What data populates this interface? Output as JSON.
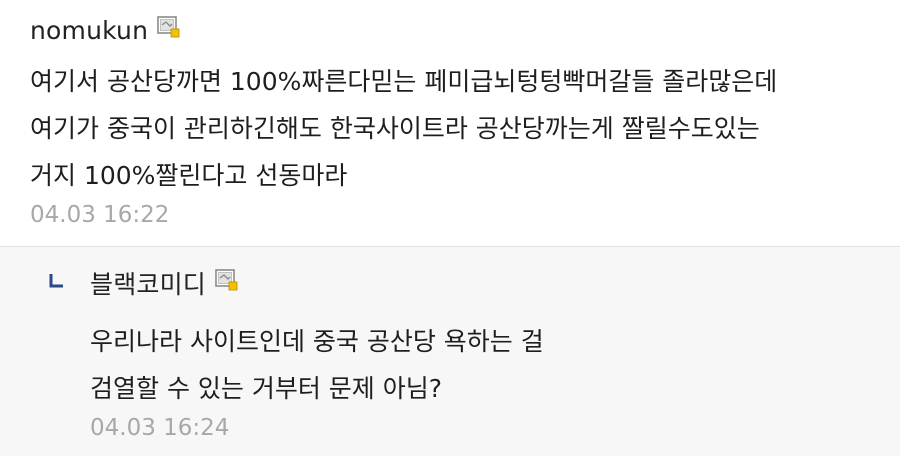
{
  "comment": {
    "author": "nomukun",
    "author_icon": "fixed-nick-icon",
    "lines": [
      "여기서 공산당까면 100%짜른다믿는 페미급뇌텅텅빡머갈들 졸라많은데",
      "여기가 중국이 관리하긴해도 한국사이트라 공산당까는게 짤릴수도있는",
      "거지 100%짤린다고 선동마라"
    ],
    "timestamp": "04.03 16:22"
  },
  "reply": {
    "reply_icon": "reply-arrow-icon",
    "author": "블랙코미디",
    "author_icon": "fixed-nick-icon",
    "lines": [
      "우리나라 사이트인데 중국 공산당 욕하는 걸",
      "검열할 수 있는 거부터 문제 아님?"
    ],
    "timestamp": "04.03 16:24"
  },
  "colors": {
    "reply_background": "#f7f7f7",
    "timestamp": "#a8a8a8",
    "reply_arrow": "#2b4a8c",
    "icon_accent": "#f2c200"
  }
}
